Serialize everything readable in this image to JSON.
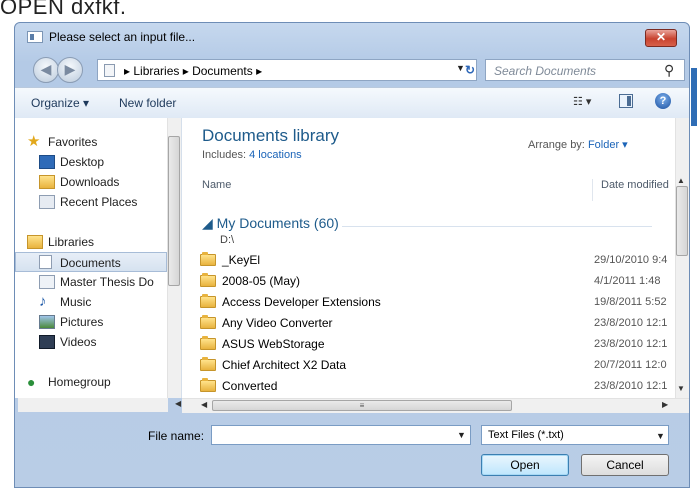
{
  "background": {
    "heading": "OPEN  dxfkf."
  },
  "dialog": {
    "title": "Please select an input file...",
    "close_label": "✕"
  },
  "address_bar": {
    "path": "▸ Libraries ▸ Documents ▸",
    "refresh_label": "↻"
  },
  "search": {
    "placeholder": "Search Documents"
  },
  "toolbar": {
    "organize_label": "Organize ▾",
    "new_folder_label": "New folder",
    "views_label": "☷ ▾"
  },
  "nav": {
    "items": [
      {
        "label": "Favorites",
        "icon": "star-icon"
      },
      {
        "label": "Desktop",
        "icon": "desktop-icon"
      },
      {
        "label": "Downloads",
        "icon": "downloads-folder-icon"
      },
      {
        "label": "Recent Places",
        "icon": "recent-places-icon"
      },
      {
        "label": "Libraries",
        "icon": "libraries-icon"
      },
      {
        "label": "Documents",
        "icon": "document-icon",
        "selected": true
      },
      {
        "label": "Master Thesis Do",
        "icon": "document-library-icon"
      },
      {
        "label": "Music",
        "icon": "music-icon"
      },
      {
        "label": "Pictures",
        "icon": "pictures-icon"
      },
      {
        "label": "Videos",
        "icon": "videos-icon"
      },
      {
        "label": "Homegroup",
        "icon": "homegroup-icon"
      }
    ]
  },
  "library": {
    "title": "Documents library",
    "includes_prefix": "Includes:",
    "includes_link": "4 locations",
    "arrange_label": "Arrange by:",
    "arrange_value": "Folder ▾"
  },
  "columns": {
    "name": "Name",
    "date_modified": "Date modified"
  },
  "group": {
    "header": "◢ My Documents (60)",
    "path": "D:\\"
  },
  "files": [
    {
      "name": "_KeyEl",
      "date": "29/10/2010 9:4"
    },
    {
      "name": "2008-05 (May)",
      "date": "4/1/2011 1:48"
    },
    {
      "name": "Access Developer Extensions",
      "date": "19/8/2011 5:52"
    },
    {
      "name": "Any Video Converter",
      "date": "23/8/2010 12:1"
    },
    {
      "name": "ASUS WebStorage",
      "date": "23/8/2010 12:1"
    },
    {
      "name": "Chief Architect X2 Data",
      "date": "20/7/2011 12:0"
    },
    {
      "name": "Converted",
      "date": "23/8/2010 12:1"
    }
  ],
  "bottom": {
    "file_name_label": "File name:",
    "file_name_value": "",
    "file_type": "Text Files (*.txt)",
    "open_label": "Open",
    "cancel_label": "Cancel"
  }
}
